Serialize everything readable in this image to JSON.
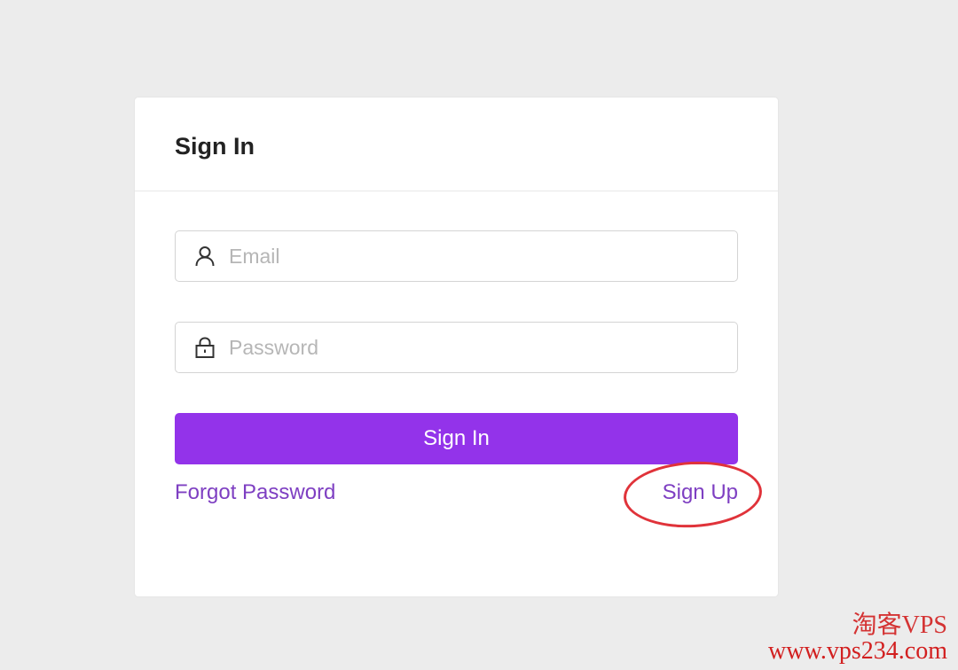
{
  "card": {
    "title": "Sign In"
  },
  "form": {
    "email_placeholder": "Email",
    "password_placeholder": "Password",
    "submit_label": "Sign In"
  },
  "links": {
    "forgot_password": "Forgot Password",
    "sign_up": "Sign Up"
  },
  "watermark": {
    "brand": "淘客VPS",
    "url": "www.vps234.com"
  },
  "colors": {
    "page_background": "#ececec",
    "primary": "#9333ea",
    "link": "#7e3fc2",
    "annotation": "#e0333a"
  },
  "icons": {
    "email": "user-icon",
    "password": "lock-icon"
  }
}
